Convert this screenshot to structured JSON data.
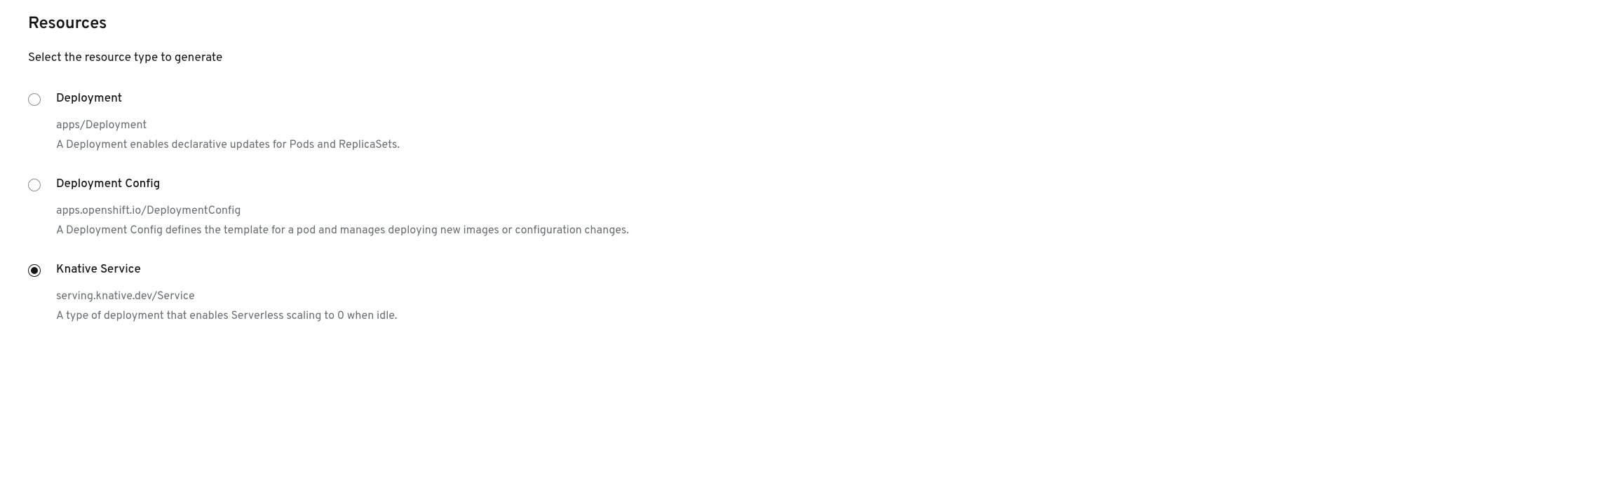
{
  "section": {
    "title": "Resources",
    "subtitle": "Select the resource type to generate"
  },
  "options": [
    {
      "label": "Deployment",
      "api": "apps/Deployment",
      "description": "A Deployment enables declarative updates for Pods and ReplicaSets.",
      "selected": false
    },
    {
      "label": "Deployment Config",
      "api": "apps.openshift.io/DeploymentConfig",
      "description": "A Deployment Config defines the template for a pod and manages deploying new images or configuration changes.",
      "selected": false
    },
    {
      "label": "Knative Service",
      "api": "serving.knative.dev/Service",
      "description": "A type of deployment that enables Serverless scaling to 0 when idle.",
      "selected": true
    }
  ]
}
